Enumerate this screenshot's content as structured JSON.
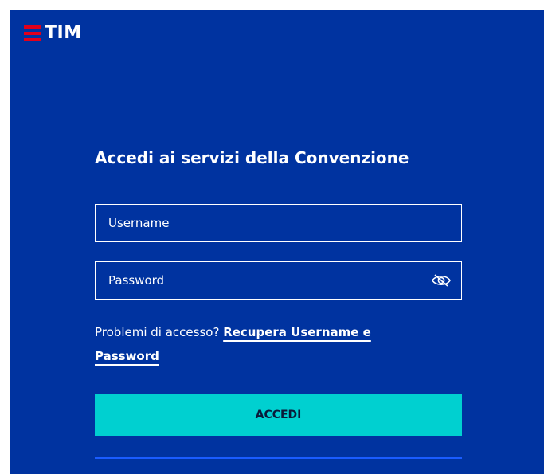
{
  "brand": {
    "logo_text": "TIM",
    "colors": {
      "background": "#0033a0",
      "logo_bars": "#e2001a",
      "button": "#00d0d0"
    }
  },
  "login": {
    "title": "Accedi ai servizi della Convenzione",
    "username_placeholder": "Username",
    "password_placeholder": "Password",
    "password_toggle_icon": "eye-slash-icon",
    "help_prefix": "Problemi di accesso?",
    "help_link": "Recupera Username e Password",
    "submit_label": "ACCEDI"
  }
}
